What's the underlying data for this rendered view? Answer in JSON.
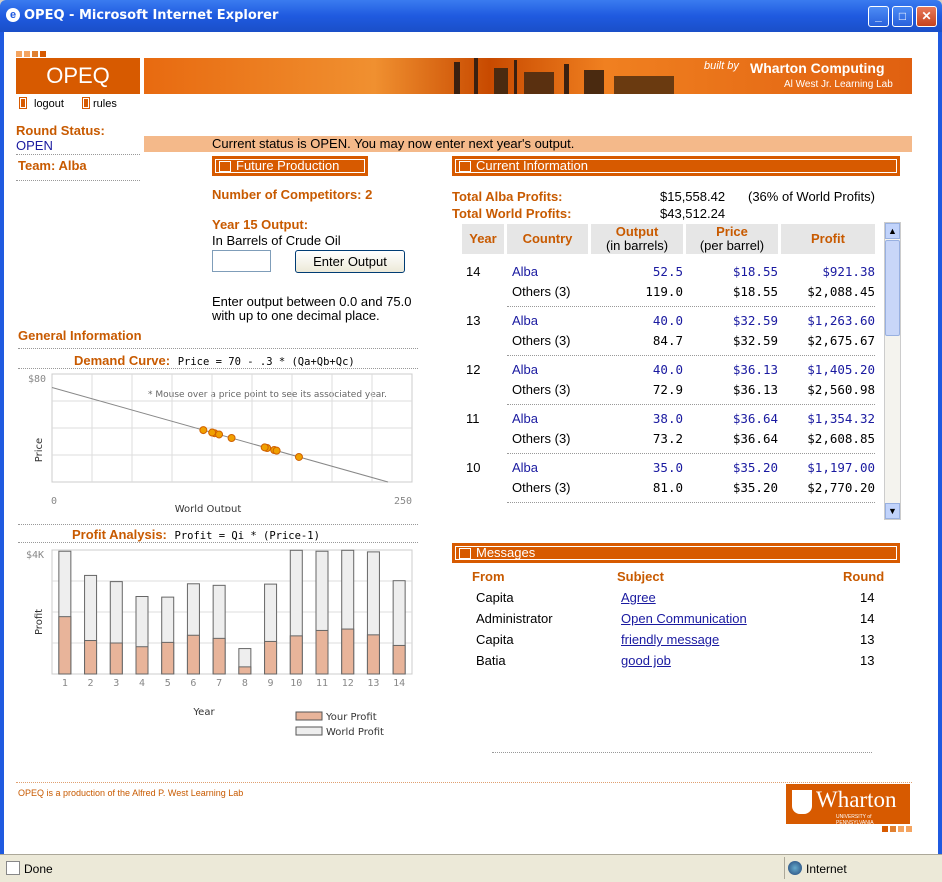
{
  "window": {
    "title": "OPEQ - Microsoft Internet Explorer",
    "status": "Done",
    "zone": "Internet"
  },
  "banner": {
    "logo": "OPEQ",
    "built_by": "built by",
    "brand": "Wharton Computing",
    "lab": "Al West Jr. Learning Lab"
  },
  "nav": {
    "logout": "logout",
    "rules": "rules"
  },
  "status": {
    "label": "Round Status:",
    "value": "OPEN",
    "message": "Current status is OPEN. You may now enter next year's output.",
    "team": "Team: Alba"
  },
  "future": {
    "header": "Future Production",
    "competitors": "Number of Competitors: 2",
    "output_label": "Year 15 Output:",
    "unit": "In Barrels of Crude Oil",
    "input_value": "",
    "button": "Enter Output",
    "hint1": "Enter output between 0.0 and 75.0",
    "hint2": "with up to one decimal place."
  },
  "current": {
    "header": "Current Information",
    "team_profit_label": "Total Alba Profits:",
    "team_profit": "$15,558.42",
    "team_share": "(36% of World Profits)",
    "world_profit_label": "Total World Profits:",
    "world_profit": "$43,512.24"
  },
  "history": {
    "headers": {
      "year": "Year",
      "country": "Country",
      "output": "Output",
      "output_sub": "(in barrels)",
      "price": "Price",
      "price_sub": "(per barrel)",
      "profit": "Profit"
    },
    "rows": [
      {
        "year": "14",
        "c1": "Alba",
        "o1": "52.5",
        "p1": "$18.55",
        "f1": "$921.38",
        "c2": "Others (3)",
        "o2": "119.0",
        "p2": "$18.55",
        "f2": "$2,088.45"
      },
      {
        "year": "13",
        "c1": "Alba",
        "o1": "40.0",
        "p1": "$32.59",
        "f1": "$1,263.60",
        "c2": "Others (3)",
        "o2": "84.7",
        "p2": "$32.59",
        "f2": "$2,675.67"
      },
      {
        "year": "12",
        "c1": "Alba",
        "o1": "40.0",
        "p1": "$36.13",
        "f1": "$1,405.20",
        "c2": "Others (3)",
        "o2": "72.9",
        "p2": "$36.13",
        "f2": "$2,560.98"
      },
      {
        "year": "11",
        "c1": "Alba",
        "o1": "38.0",
        "p1": "$36.64",
        "f1": "$1,354.32",
        "c2": "Others (3)",
        "o2": "73.2",
        "p2": "$36.64",
        "f2": "$2,608.85"
      },
      {
        "year": "10",
        "c1": "Alba",
        "o1": "35.0",
        "p1": "$35.20",
        "f1": "$1,197.00",
        "c2": "Others (3)",
        "o2": "81.0",
        "p2": "$35.20",
        "f2": "$2,770.20"
      }
    ]
  },
  "general": {
    "header": "General Information",
    "demand_title": "Demand Curve:",
    "demand_formula": "Price = 70 - .3 * (Qa+Qb+Qc)",
    "demand_note": "* Mouse over a price point to see its associated year.",
    "profit_title": "Profit Analysis:",
    "profit_formula": "Profit = Qi * (Price-1)"
  },
  "messages": {
    "header": "Messages",
    "cols": {
      "from": "From",
      "subject": "Subject",
      "round": "Round"
    },
    "items": [
      {
        "from": "Capita",
        "subject": "Agree",
        "round": "14"
      },
      {
        "from": "Administrator",
        "subject": "Open Communication",
        "round": "14"
      },
      {
        "from": "Capita",
        "subject": "friendly message",
        "round": "13"
      },
      {
        "from": "Batia",
        "subject": "good job",
        "round": "13"
      }
    ]
  },
  "footer": {
    "text": "OPEQ is a production of the Alfred P. West Learning Lab",
    "logo": "Wharton",
    "logo_sub": "UNIVERSITY of PENNSYLVANIA"
  },
  "chart_data": [
    {
      "type": "scatter",
      "title": "Demand Curve",
      "xlabel": "World Output",
      "ylabel": "Price",
      "xlim": [
        0,
        250
      ],
      "ylim": [
        0,
        80
      ],
      "x_ticks": [
        "0",
        "250"
      ],
      "y_ticks": [
        "$80"
      ],
      "line": {
        "intercept": 70,
        "slope": -0.3
      },
      "x": [
        171.5,
        124.7,
        112.9,
        111.2,
        116.0,
        149.4,
        147.7,
        154.3,
        156.0,
        105.1
      ],
      "y": [
        18.55,
        32.59,
        36.13,
        36.64,
        35.2,
        25.18,
        25.69,
        23.71,
        23.2,
        38.47
      ]
    },
    {
      "type": "bar",
      "title": "Profit Analysis",
      "xlabel": "Year",
      "ylabel": "Profit",
      "ylim": [
        0,
        4000
      ],
      "y_ticks": [
        "$4K"
      ],
      "categories": [
        "1",
        "2",
        "3",
        "4",
        "5",
        "6",
        "7",
        "8",
        "9",
        "10",
        "11",
        "12",
        "13",
        "14"
      ],
      "series": [
        {
          "name": "Your Profit",
          "values": [
            1850,
            1080,
            1000,
            880,
            1020,
            1250,
            1150,
            230,
            1050,
            1230,
            1405,
            1450,
            1263,
            921
          ]
        },
        {
          "name": "World Profit",
          "values": [
            3960,
            3180,
            2980,
            2500,
            2480,
            2910,
            2860,
            820,
            2900,
            3990,
            3960,
            3990,
            3939,
            3010
          ]
        }
      ],
      "legend": "bottom-right"
    }
  ]
}
